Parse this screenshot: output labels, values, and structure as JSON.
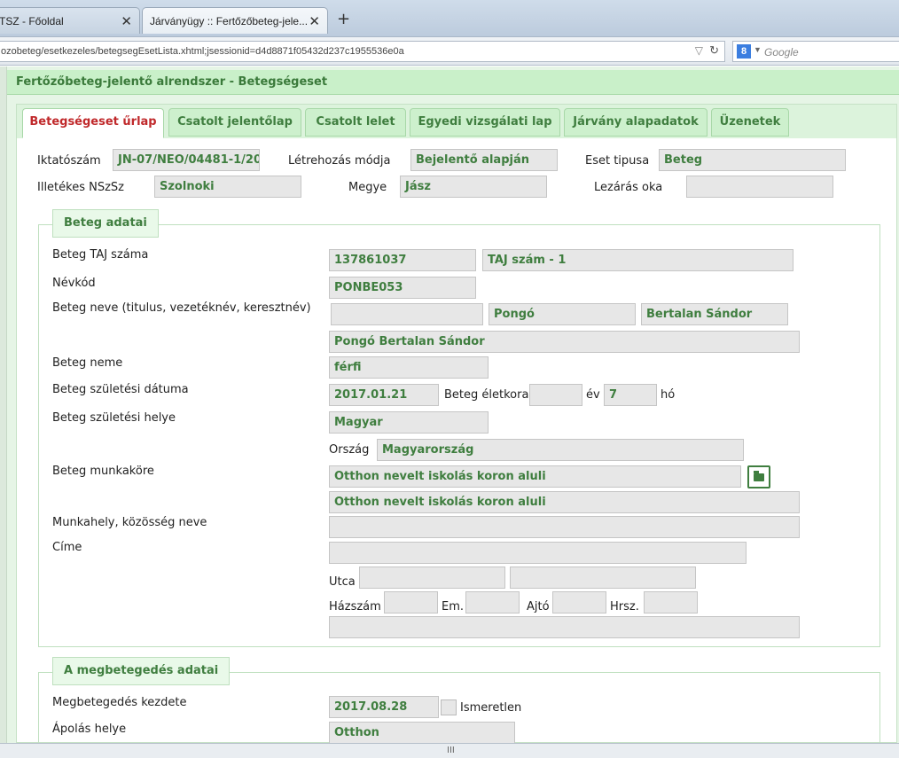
{
  "browser": {
    "tabs": [
      {
        "label": "TSZ - Főoldal"
      },
      {
        "label": "Járványügy :: Fertőzőbeteg-jele..."
      }
    ],
    "new_tab": "+",
    "close_glyph": "✕",
    "url": "ozobeteg/esetkezeles/betegsegEsetLista.xhtml;jsessionid=d4d8871f05432d237c1955536e0a",
    "search_placeholder": "Google",
    "search_engine_icon": "8"
  },
  "app": {
    "title": "Fertőzőbeteg-jelentő alrendszer - Betegségeset"
  },
  "tabs": [
    {
      "label": "Betegségeset űrlap"
    },
    {
      "label": "Csatolt jelentőlap"
    },
    {
      "label": "Csatolt lelet"
    },
    {
      "label": "Egyedi vizsgálati lap"
    },
    {
      "label": "Járvány alapadatok"
    },
    {
      "label": "Üzenetek"
    }
  ],
  "header": {
    "iktatoszam_label": "Iktatószám",
    "iktatoszam": "JN-07/NEO/04481-1/20",
    "letrehozas_label": "Létrehozás módja",
    "letrehozas": "Bejelentő alapján",
    "eset_label": "Eset tipusa",
    "eset": "Beteg",
    "nszsz_label": "Illetékes NSzSz",
    "nszsz": "Szolnoki",
    "megye_label": "Megye",
    "megye": "Jász",
    "lezaras_label": "Lezárás oka",
    "lezaras": ""
  },
  "beteg": {
    "legend": "Beteg adatai",
    "taj_label": "Beteg TAJ száma",
    "taj": "137861037",
    "taj_type": "TAJ szám - 1",
    "nevkod_label": "Névkód",
    "nevkod": "PONBE053",
    "nev_label": "Beteg neve (titulus, vezetéknév, keresztnév)",
    "titulus": "",
    "vezeteknev": "Pongó",
    "keresztnev": "Bertalan Sándor",
    "teljes_nev": "Pongó Bertalan Sándor",
    "nem_label": "Beteg neme",
    "nem": "férfi",
    "szul_datum_label": "Beteg születési dátuma",
    "szul_datum": "2017.01.21",
    "eletkor_label": "Beteg életkora",
    "eletkor_ev": "",
    "ev_label": "év",
    "eletkor_ho": "7",
    "ho_label": "hó",
    "szul_hely_label": "Beteg születési helye",
    "szul_hely": "Magyar",
    "orszag_label": "Ország",
    "orszag": "Magyarország",
    "munkakor_label": "Beteg munkaköre",
    "munkakor": "Otthon nevelt iskolás koron aluli",
    "munkakor_desc": "Otthon nevelt iskolás koron aluli",
    "munkahely_label": "Munkahely, közösség neve",
    "munkahely": "",
    "cim_label": "Címe",
    "cim": "",
    "utca_label": "Utca",
    "utca1": "",
    "utca2": "",
    "hazszam_label": "Házszám",
    "hazszam": "",
    "em_label": "Em.",
    "em": "",
    "ajto_label": "Ajtó",
    "ajto": "",
    "hrsz_label": "Hrsz.",
    "hrsz": "",
    "cim_osszesitett": ""
  },
  "megbetegedes": {
    "legend": "A megbetegedés adatai",
    "kezdete_label": "Megbetegedés kezdete",
    "kezdete": "2017.08.28",
    "ismeretlen_label": "Ismeretlen",
    "ismeretlen_checked": false,
    "apolas_label": "Ápolás helye",
    "apolas": "Otthon"
  },
  "statusbar": {
    "grip": "III"
  }
}
